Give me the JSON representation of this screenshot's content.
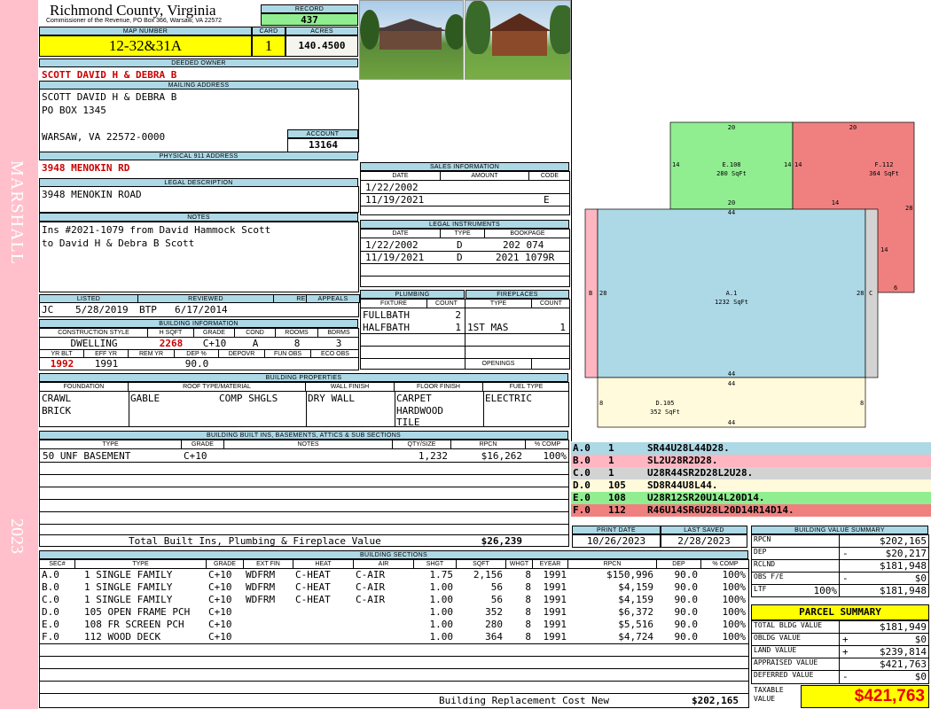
{
  "side_banner": {
    "district": "MARSHALL",
    "year": "2023"
  },
  "header": {
    "county": "Richmond County, Virginia",
    "commissioner": "Commissioner of the Revenue, PO Box 366, Warsaw, VA 22572",
    "record_label": "RECORD",
    "record": "437",
    "map_label": "MAP NUMBER",
    "map_number": "12-32&31A",
    "card_label": "CARD",
    "card": "1",
    "acres_label": "ACRES",
    "acres": "140.4500"
  },
  "owner": {
    "deeded_label": "DEEDED OWNER",
    "deeded_owner": "SCOTT DAVID H & DEBRA B",
    "mailing_label": "MAILING ADDRESS",
    "mailing_line1": "SCOTT DAVID H & DEBRA B",
    "mailing_line2": "PO BOX 1345",
    "mailing_line3": "WARSAW, VA 22572-0000",
    "account_label": "ACCOUNT",
    "account": "13164",
    "physical_label": "PHYSICAL 911 ADDRESS",
    "physical": "3948 MENOKIN RD",
    "legal_label": "LEGAL DESCRIPTION",
    "legal": "3948 MENOKIN ROAD",
    "notes_label": "NOTES",
    "notes_line1": "Ins #2021-1079 from David Hammock Scott",
    "notes_line2": "to David H & Debra B Scott"
  },
  "sales": {
    "title": "SALES INFORMATION",
    "cols": [
      "DATE",
      "AMOUNT",
      "CODE"
    ],
    "rows": [
      {
        "date": "1/22/2002",
        "amount": "",
        "code": ""
      },
      {
        "date": "11/19/2021",
        "amount": "",
        "code": "E"
      }
    ]
  },
  "instruments": {
    "title": "LEGAL INSTRUMENTS",
    "cols": [
      "DATE",
      "TYPE",
      "BOOKPAGE"
    ],
    "rows": [
      {
        "date": "1/22/2002",
        "type": "D",
        "bookpage": "202 074"
      },
      {
        "date": "11/19/2021",
        "type": "D",
        "bookpage": "2021 1079R"
      }
    ]
  },
  "review": {
    "cols": [
      "LISTED",
      "REVIEWED",
      "REVISIT",
      "APPEALS"
    ],
    "listed_by": "JC",
    "listed_date": "5/28/2019",
    "reviewed_by": "BTP",
    "reviewed_date": "6/17/2014"
  },
  "building_info": {
    "title": "BUILDING INFORMATION",
    "cols": [
      "CONSTRUCTION STYLE",
      "H SQFT",
      "GRADE",
      "COND",
      "ROOMS",
      "BDRMS"
    ],
    "style": "DWELLING",
    "hsqft": "2268",
    "grade": "C+10",
    "cond": "A",
    "rooms": "8",
    "bdrms": "3",
    "cols2": [
      "YR BLT",
      "EFF YR",
      "REM YR",
      "DEP %",
      "DEPOVR",
      "FUN OBS",
      "ECO OBS"
    ],
    "yr_blt": "1992",
    "eff_yr": "1991",
    "dep": "90.0"
  },
  "plumbing": {
    "title": "PLUMBING",
    "cols": [
      "FIXTURE",
      "COUNT"
    ],
    "rows": [
      {
        "fixture": "FULLBATH",
        "count": "2"
      },
      {
        "fixture": "HALFBATH",
        "count": "1"
      }
    ]
  },
  "fireplaces": {
    "title": "FIREPLACES",
    "cols": [
      "TYPE",
      "COUNT"
    ],
    "rows": [
      {
        "type": "1ST MAS",
        "count": "1"
      }
    ],
    "openings_label": "OPENINGS"
  },
  "properties": {
    "title": "BUILDING PROPERTIES",
    "cols": [
      "FOUNDATION",
      "ROOF TYPE/MATERIAL",
      "WALL FINISH",
      "FLOOR FINISH",
      "FUEL TYPE"
    ],
    "foundation": [
      "CRAWL",
      "BRICK"
    ],
    "roof_type": "GABLE",
    "roof_material": "COMP SHGLS",
    "wall": "DRY WALL",
    "floor": [
      "CARPET",
      "HARDWOOD",
      "TILE"
    ],
    "fuel": "ELECTRIC"
  },
  "builtins": {
    "title": "BUILDING BUILT INS, BASEMENTS, ATTICS & SUB SECTIONS",
    "cols": [
      "TYPE",
      "GRADE",
      "NOTES",
      "QTY/SIZE",
      "RPCN",
      "% COMP"
    ],
    "rows": [
      {
        "type": "50 UNF BASEMENT",
        "grade": "C+10",
        "notes": "",
        "qty": "1,232",
        "rpcn": "$16,262",
        "comp": "100%"
      }
    ],
    "total_label": "Total Built Ins, Plumbing & Fireplace Value",
    "total": "$26,239"
  },
  "sketch": {
    "areas": [
      {
        "code": "A.1",
        "sqft": "1232 SqFt"
      },
      {
        "code": "D.105",
        "sqft": "352 SqFt"
      },
      {
        "code": "E.108",
        "sqft": "280 SqFt"
      },
      {
        "code": "F.112",
        "sqft": "364 SqFt"
      }
    ],
    "side_labels": {
      "b": "B",
      "c": "C"
    },
    "dims": {
      "e_top": "20",
      "e_left": "14",
      "e_right": "14",
      "e_bottom": "20",
      "f_top": "20",
      "f_left": "14",
      "f_right": "28",
      "f_inner": "14",
      "f_bottom": "14",
      "f_small": "6",
      "a_top": "44",
      "a_left": "28",
      "a_right": "28",
      "a_bottom": "44",
      "d_top": "44",
      "d_left": "8",
      "d_right": "8",
      "d_bottom": "44"
    },
    "colors": {
      "a": "#add8e6",
      "b": "#ffb6c1",
      "c": "#d3d3d3",
      "d": "#fffadc",
      "e": "#90ee90",
      "f": "#f08080"
    }
  },
  "vectors": [
    {
      "sec": "A.0",
      "code": "1",
      "vec": "SR44U28L44D28.",
      "color": "#add8e6"
    },
    {
      "sec": "B.0",
      "code": "1",
      "vec": "SL2U28R2D28.",
      "color": "#ffb6c1"
    },
    {
      "sec": "C.0",
      "code": "1",
      "vec": "U28R44SR2D28L2U28.",
      "color": "#d3d3d3"
    },
    {
      "sec": "D.0",
      "code": "105",
      "vec": "SD8R44U8L44.",
      "color": "#fffadc"
    },
    {
      "sec": "E.0",
      "code": "108",
      "vec": "U28R12SR20U14L20D14.",
      "color": "#90ee90"
    },
    {
      "sec": "F.0",
      "code": "112",
      "vec": "R46U14SR6U28L20D14R14D14.",
      "color": "#f08080"
    }
  ],
  "dates": {
    "print_label": "PRINT DATE",
    "print": "10/26/2023",
    "saved_label": "LAST SAVED",
    "saved": "2/28/2023"
  },
  "sections": {
    "title": "BUILDING SECTIONS",
    "cols": [
      "SEC#",
      "TYPE",
      "GRADE",
      "EXT FIN",
      "HEAT",
      "AIR",
      "SHGT",
      "SQFT",
      "WHGT",
      "EYEAR",
      "RPCN",
      "DEP",
      "% COMP"
    ],
    "rows": [
      {
        "sec": "A.0",
        "type": "1 SINGLE FAMILY",
        "grade": "C+10",
        "ext": "WDFRM",
        "heat": "C-HEAT",
        "air": "C-AIR",
        "shgt": "1.75",
        "sqft": "2,156",
        "whgt": "8",
        "eyear": "1991",
        "rpcn": "$150,996",
        "dep": "90.0",
        "comp": "100%"
      },
      {
        "sec": "B.0",
        "type": "1 SINGLE FAMILY",
        "grade": "C+10",
        "ext": "WDFRM",
        "heat": "C-HEAT",
        "air": "C-AIR",
        "shgt": "1.00",
        "sqft": "56",
        "whgt": "8",
        "eyear": "1991",
        "rpcn": "$4,159",
        "dep": "90.0",
        "comp": "100%"
      },
      {
        "sec": "C.0",
        "type": "1 SINGLE FAMILY",
        "grade": "C+10",
        "ext": "WDFRM",
        "heat": "C-HEAT",
        "air": "C-AIR",
        "shgt": "1.00",
        "sqft": "56",
        "whgt": "8",
        "eyear": "1991",
        "rpcn": "$4,159",
        "dep": "90.0",
        "comp": "100%"
      },
      {
        "sec": "D.0",
        "type": "105 OPEN FRAME PCH",
        "grade": "C+10",
        "ext": "",
        "heat": "",
        "air": "",
        "shgt": "1.00",
        "sqft": "352",
        "whgt": "8",
        "eyear": "1991",
        "rpcn": "$6,372",
        "dep": "90.0",
        "comp": "100%"
      },
      {
        "sec": "E.0",
        "type": "108 FR SCREEN PCH",
        "grade": "C+10",
        "ext": "",
        "heat": "",
        "air": "",
        "shgt": "1.00",
        "sqft": "280",
        "whgt": "8",
        "eyear": "1991",
        "rpcn": "$5,516",
        "dep": "90.0",
        "comp": "100%"
      },
      {
        "sec": "F.0",
        "type": "112 WOOD DECK",
        "grade": "C+10",
        "ext": "",
        "heat": "",
        "air": "",
        "shgt": "1.00",
        "sqft": "364",
        "whgt": "8",
        "eyear": "1991",
        "rpcn": "$4,724",
        "dep": "90.0",
        "comp": "100%"
      }
    ],
    "total_label": "Building Replacement Cost New",
    "total": "$202,165"
  },
  "value_summary": {
    "title": "BUILDING VALUE SUMMARY",
    "rows": [
      {
        "label": "RPCN",
        "sign": "",
        "pct": "",
        "value": "$202,165"
      },
      {
        "label": "DEP",
        "sign": "-",
        "pct": "",
        "value": "$20,217"
      },
      {
        "label": "RCLND",
        "sign": "",
        "pct": "",
        "value": "$181,948"
      },
      {
        "label": "OBS F/E",
        "sign": "-",
        "pct": "",
        "value": "$0"
      },
      {
        "label": "LTF",
        "sign": "",
        "pct": "100%",
        "value": "$181,948"
      }
    ]
  },
  "parcel": {
    "title": "PARCEL SUMMARY",
    "rows": [
      {
        "label": "TOTAL BLDG VALUE",
        "sign": "",
        "value": "$181,949"
      },
      {
        "label": "OBLDG VALUE",
        "sign": "+",
        "value": "$0"
      },
      {
        "label": "LAND VALUE",
        "sign": "+",
        "value": "$239,814"
      },
      {
        "label": "APPRAISED VALUE",
        "sign": "",
        "value": "$421,763"
      },
      {
        "label": "DEFERRED VALUE",
        "sign": "-",
        "value": "$0"
      }
    ],
    "taxable_label": "TAXABLE VALUE",
    "taxable": "$421,763"
  }
}
